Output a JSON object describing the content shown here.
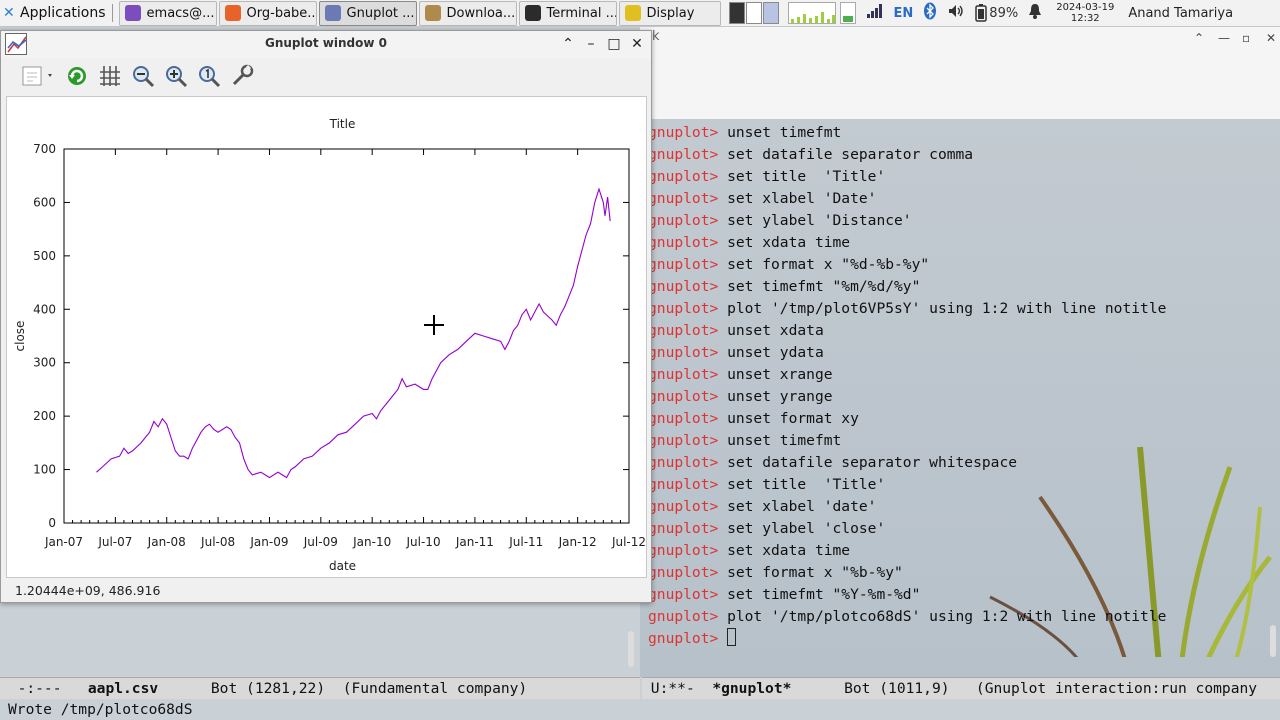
{
  "taskbar": {
    "applications_label": "Applications",
    "tasks": [
      {
        "label": "emacs@...",
        "icon": "emacs-icon",
        "color": "#7c4dbd"
      },
      {
        "label": "Org-babe...",
        "icon": "firefox-icon",
        "color": "#e8632a"
      },
      {
        "label": "Gnuplot ...",
        "icon": "gnuplot-icon",
        "color": "#6b7ab5"
      },
      {
        "label": "Downloa...",
        "icon": "folder-icon",
        "color": "#b08a4a"
      },
      {
        "label": "Terminal ...",
        "icon": "terminal-icon",
        "color": "#2b2b2b"
      },
      {
        "label": "Display",
        "icon": "display-icon",
        "color": "#e0c020"
      }
    ],
    "keyboard_layout": "EN",
    "battery": "89%",
    "date": "2024-03-19",
    "time": "12:32",
    "user": "Anand Tamariya"
  },
  "gnuplot_window": {
    "title": "Gnuplot window 0",
    "status": "1.20444e+09,  486.916"
  },
  "chart_data": {
    "type": "line",
    "title": "Title",
    "xlabel": "date",
    "ylabel": "close",
    "xticks": [
      "Jan-07",
      "Jul-07",
      "Jan-08",
      "Jul-08",
      "Jan-09",
      "Jul-09",
      "Jan-10",
      "Jul-10",
      "Jan-11",
      "Jul-11",
      "Jan-12",
      "Jul-12"
    ],
    "yticks": [
      0,
      100,
      200,
      300,
      400,
      500,
      600,
      700
    ],
    "ylim": [
      0,
      700
    ],
    "x_unit": "months since Jan-07",
    "xlim": [
      0,
      66
    ],
    "legend": "none",
    "series": [
      {
        "color": "#9400d3",
        "points": [
          [
            3.8,
            95
          ],
          [
            4.5,
            105
          ],
          [
            5.5,
            120
          ],
          [
            6.5,
            125
          ],
          [
            7.0,
            140
          ],
          [
            7.5,
            130
          ],
          [
            8.0,
            135
          ],
          [
            9.0,
            150
          ],
          [
            10.0,
            170
          ],
          [
            10.5,
            190
          ],
          [
            11.0,
            180
          ],
          [
            11.5,
            195
          ],
          [
            12.0,
            185
          ],
          [
            12.5,
            160
          ],
          [
            13.0,
            135
          ],
          [
            13.5,
            125
          ],
          [
            14.0,
            125
          ],
          [
            14.5,
            120
          ],
          [
            15.0,
            140
          ],
          [
            15.5,
            155
          ],
          [
            16.0,
            170
          ],
          [
            16.5,
            180
          ],
          [
            17.0,
            185
          ],
          [
            17.5,
            175
          ],
          [
            18.0,
            170
          ],
          [
            19.0,
            180
          ],
          [
            19.5,
            175
          ],
          [
            20.0,
            160
          ],
          [
            20.5,
            150
          ],
          [
            21.0,
            120
          ],
          [
            21.5,
            100
          ],
          [
            22.0,
            90
          ],
          [
            23.0,
            95
          ],
          [
            23.5,
            90
          ],
          [
            24.0,
            85
          ],
          [
            25.0,
            95
          ],
          [
            25.5,
            90
          ],
          [
            26.0,
            85
          ],
          [
            26.5,
            100
          ],
          [
            27.0,
            105
          ],
          [
            28.0,
            120
          ],
          [
            29.0,
            125
          ],
          [
            30.0,
            140
          ],
          [
            31.0,
            150
          ],
          [
            32.0,
            165
          ],
          [
            33.0,
            170
          ],
          [
            34.0,
            185
          ],
          [
            35.0,
            200
          ],
          [
            36.0,
            205
          ],
          [
            36.5,
            195
          ],
          [
            37.0,
            210
          ],
          [
            38.0,
            230
          ],
          [
            39.0,
            250
          ],
          [
            39.5,
            270
          ],
          [
            40.0,
            255
          ],
          [
            41.0,
            260
          ],
          [
            42.0,
            250
          ],
          [
            42.5,
            250
          ],
          [
            43.0,
            270
          ],
          [
            44.0,
            300
          ],
          [
            45.0,
            315
          ],
          [
            46.0,
            325
          ],
          [
            47.0,
            340
          ],
          [
            48.0,
            355
          ],
          [
            49.0,
            350
          ],
          [
            50.0,
            345
          ],
          [
            51.0,
            340
          ],
          [
            51.5,
            325
          ],
          [
            52.0,
            340
          ],
          [
            52.5,
            360
          ],
          [
            53.0,
            370
          ],
          [
            53.5,
            390
          ],
          [
            54.0,
            400
          ],
          [
            54.5,
            380
          ],
          [
            55.0,
            395
          ],
          [
            55.5,
            410
          ],
          [
            56.0,
            395
          ],
          [
            57.0,
            380
          ],
          [
            57.5,
            370
          ],
          [
            58.0,
            390
          ],
          [
            58.5,
            405
          ],
          [
            59.0,
            425
          ],
          [
            59.5,
            445
          ],
          [
            60.0,
            480
          ],
          [
            60.5,
            510
          ],
          [
            61.0,
            540
          ],
          [
            61.5,
            560
          ],
          [
            62.0,
            600
          ],
          [
            62.5,
            625
          ],
          [
            63.0,
            600
          ],
          [
            63.2,
            575
          ],
          [
            63.5,
            610
          ],
          [
            63.8,
            565
          ]
        ]
      }
    ]
  },
  "terminal": {
    "prompt": "gnuplot>",
    "lines": [
      "unset timefmt",
      "set datafile separator comma",
      "set title  'Title'",
      "set xlabel 'Date'",
      "set ylabel 'Distance'",
      "set xdata time",
      "set format x \"%d-%b-%y\"",
      "set timefmt \"%m/%d/%y\"",
      "plot '/tmp/plot6VP5sY' using 1:2 with line notitle",
      "unset xdata",
      "unset ydata",
      "unset xrange",
      "unset yrange",
      "unset format xy",
      "unset timefmt",
      "set datafile separator whitespace",
      "set title  'Title'",
      "set xlabel 'date'",
      "set ylabel 'close'",
      "set xdata time",
      "set format x \"%b-%y\"",
      "set timefmt \"%Y-%m-%d\"",
      "plot '/tmp/plotco68dS' using 1:2 with line notitle"
    ]
  },
  "modeline_left": {
    "status": "-:---",
    "buffer": "aapl.csv",
    "position": "Bot (1281,22)",
    "modes": "(Fundamental company)"
  },
  "modeline_right": {
    "status": "U:**-",
    "buffer": "*gnuplot*",
    "position": "Bot (1011,9)",
    "modes": "(Gnuplot interaction:run company"
  },
  "echo_area": "Wrote /tmp/plotco68dS"
}
